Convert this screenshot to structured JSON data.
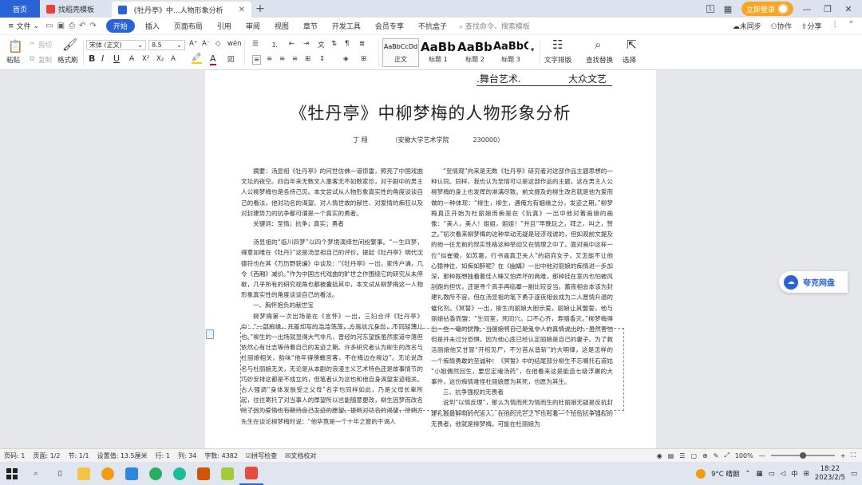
{
  "tabs": {
    "home": "首页",
    "templates": "找稻壳模板",
    "doc": "《牡丹亭》中...人物形象分析"
  },
  "window": {
    "login": "立即登录",
    "badge": "1"
  },
  "menu": {
    "file": "文件",
    "items": [
      "开始",
      "插入",
      "页面布局",
      "引用",
      "审阅",
      "视图",
      "章节",
      "开发工具",
      "会员专享",
      "不抗盒子"
    ],
    "search": "查找命令、搜索模板",
    "right": [
      "未同步",
      "协作",
      "分享"
    ]
  },
  "ribbon": {
    "cut": "剪切",
    "copy": "复制",
    "paste": "粘贴",
    "format_painter": "格式刷",
    "font": "宋体 (正文)",
    "size": "8.5",
    "styles": [
      {
        "preview": "AaBbCcDd",
        "label": "正文"
      },
      {
        "preview": "AaBb",
        "label": "标题 1"
      },
      {
        "preview": "AaBb(",
        "label": "标题 2"
      },
      {
        "preview": "AaBbC",
        "label": "标题 3"
      }
    ],
    "text_layout": "文字排版",
    "find_replace": "查找替换",
    "select": "选择"
  },
  "document": {
    "header_left": ".舞台艺术.",
    "header_right": "大众文艺",
    "title": "《牡丹亭》中柳梦梅的人物形象分析",
    "author": "丁 翔",
    "affiliation": "（安徽大学艺术学院",
    "postcode": "230000）",
    "left_col": [
      "摘要：汤显祖《牡丹亭》的问世仿佛一道惊雷，照亮了中国戏曲文坛的夜空。四百年来无数文人墨客无不如数家珍，对于剧中的男主人公柳梦梅也是各持己见。本文尝试从人物形象真实性的角度谈谈自己的看法，他对功名的渴望、对人情世故的献世、对爱情的痴狂以及对封建势力的抗争都可谓是一个真实的勇者。",
      "关键词：至情；抗争；真实；勇者",
      "汤显祖的“临川四梦”以四个梦境演绎世间纷繁事。“一生四梦，得意如唯在《牡丹》”这是汤显祖自己的评价。提起《牡丹亭》明代沈德符也在其《万历野获编》中谈及：“《牡丹亭》一出，家传户诵，几令《西厢》减价。”作为中国古代戏曲的旷世之作围绕它的研究从未停歇，几乎所有的研究视角也都被囊括其中，本文试从柳梦梅这一人物形象真实性的角度谈谈自己的看法。",
      "一、胸怀抱负的献世宝",
      "柳梦梅第一次出场是在《言怀》一出，三妇合评《牡丹亭》中：“一部痴缘，开首却写的浩浩荡荡，方是状元身份，不同轻薄儿也。”柳生的一出场就显得大气非凡，曾经的河东望族虽然家道中落但依然心有壮志等待着自己的发迹之期。许多研究者认为柳生的改名与杜丽娘相关，韵味“他年得傍蟾宫客，不在梅边在柳边”。无论说改名与杜丽娘无关，无论是从本剧的浪漫主义艺术特色还是故事情节的巧妙安排这都是不成立的，但笔者认为这也和他自身渴望发迹相关。古人强调“身体发肤受之父母”名字也同样如此，乃是父母长辈所起，往往寄托了对当事人的厚望所以岂能随意更改，柳生因梦而改名除了因为爱情也有期待自己发迹的愿望。提到对功名的渴望，徐朔方先生在谈论柳梦梅时说：“他毕竟是一个十年之窗的干谒人"
    ],
    "right_col": [
      "“至情观”向来是无数《牡丹亭》研究者对这部作品主题思想的一种认同。同样，我也认为至情可以是这部作品的主题，这在男主人公柳梦梅的身上也发挥的淋漓尽致。前文提及的柳生改名就是他为爱而做的一种体现：“柳生，柳生，遇俺方有姻缘之分，发迹之期。”柳梦梅真正开始为杜丽娘而痴是在《玩真》一出中他对着画娘的画像：“美人，美人！姐姐，姐姐！”并且“早晚玩之，拜之，叫之，赞之。”初次看来柳梦梅的这种举动无疑是轻浮戏谑的，但如观前文提及的他一往无前的现实性格这种举动又在情理之中了。面对画中这样一位“似崔徽，如苏惠，行书逼真卫夫人”的窈窕女子，又怎能不让他心猿神往、如痴如醉呢？在《幽媾》一出中他对丽娘的痴情进一步加深，那种既想独看着佳人睡又怕弄坏的两难，那种挂在室内也怕被风刮跑的担忧，还是寻个高手再临摹一副比较妥当。蓄夜相会本该为封建礼教所不容，但在汤显祖的笔下勇于逐夜相会成为二人愿情升温的催化剂。《冥誓》一出，柳生向丽娘大胆示爱，丽娘让其盟誓，他与丽娘拈香而盟：“生同室，死同穴。口不心齐，寿随香灭。”柳梦梅得出一些一毫的犹豫。当丽娘将自己是鬼非人的真情说出时，虽然害怕但是并未过分恐惧，因为他心底已经认定丽娘是自己的妻子。为了救活丽娘他又甘冒“开棺见尸，不分首从皆斩”的大明律，这是怎样的一个痴情勇敢的至诚种！《冥誓》中的结尾部分柳生不忘嘱托石道姑 “小姐偶然回生，要您定魂汤药”，在他看来这是能造七级浮屠的大事件，这份痴情难怪杜丽娘愿为其死，也愿为其生。",
      "三、抗争强权的无畏者",
      "说到“以情反理”，那么为情而死为情而生的杜丽娘无疑是反抗封建礼教最鲜明的代言人，在他的光芒之下也有着一个恰恰抗争强权的无畏者，他就是柳梦梅。可能在杜丽娘为"
    ]
  },
  "cloud": {
    "label": "夸克网盘"
  },
  "status": {
    "items": [
      "页码: 1",
      "页面: 1/2",
      "节: 1/1",
      "设置值: 13.5厘米",
      "行: 1",
      "列: 34",
      "字数: 4382",
      "拼写检查",
      "文档校对"
    ],
    "zoom": "100%"
  },
  "taskbar": {
    "weather": "9°C  晴朗",
    "ime": "中",
    "time": "18:22",
    "date": "2023/2/5"
  }
}
